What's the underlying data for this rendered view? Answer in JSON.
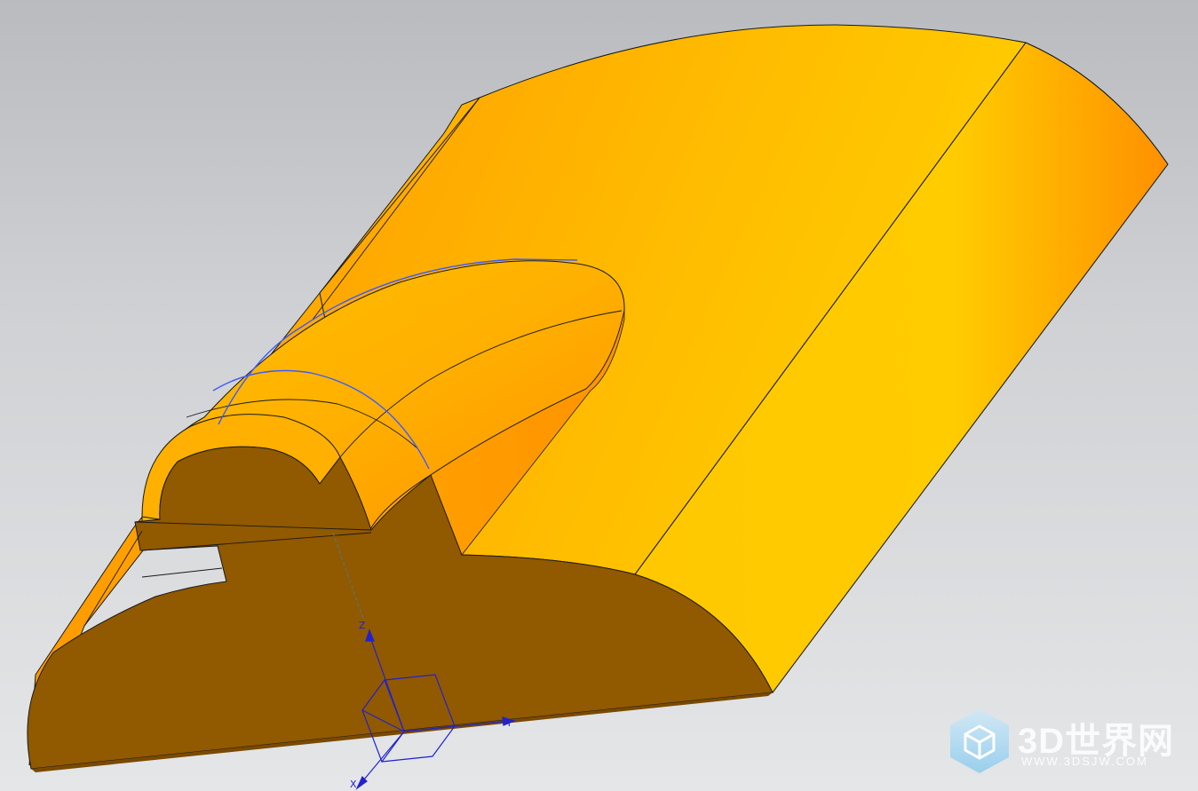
{
  "viewport": {
    "background_top": "#b9bbbf",
    "background_bottom": "#e4e6e8"
  },
  "model": {
    "face_color": "#ffc400",
    "face_shadow_color": "#ff9a00",
    "section_color": "#915900",
    "edge_color": "#1a1a1a",
    "curve_color": "#3b5bff"
  },
  "triad": {
    "z_label": "Z",
    "y_label": "Y",
    "x_label": "X",
    "color": "#2222cc"
  },
  "watermark": {
    "title": "3D世界网",
    "url": "WWW.3DSJW.COM",
    "icon": "cube-icon"
  }
}
